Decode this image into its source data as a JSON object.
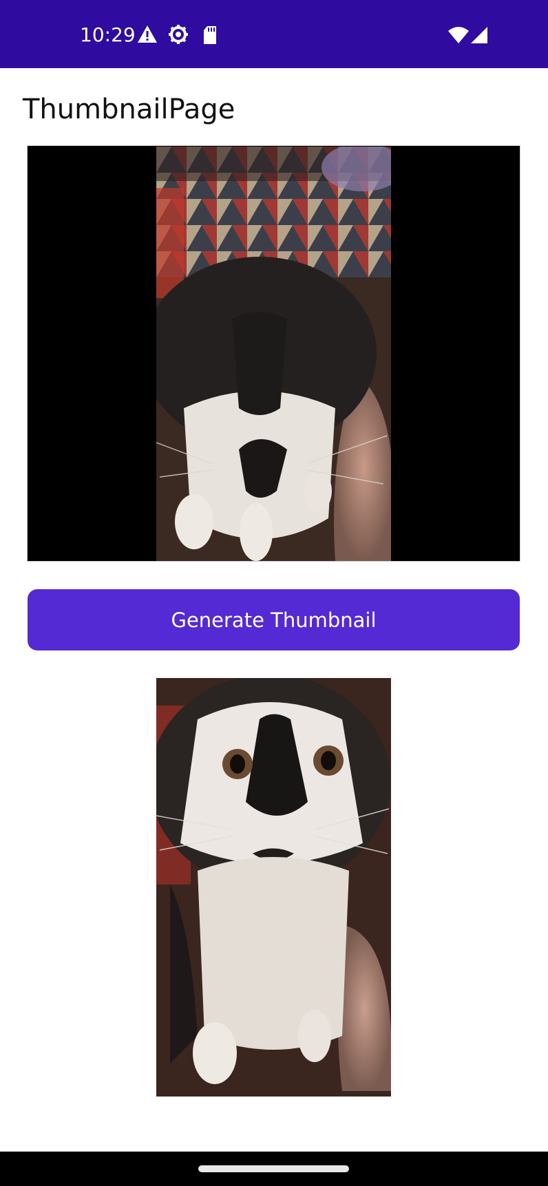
{
  "status_bar": {
    "time": "10:29",
    "icons": [
      "warning-icon",
      "gear-icon",
      "sd-card-icon",
      "wifi-icon",
      "cellular-signal-icon"
    ]
  },
  "page": {
    "title": "ThumbnailPage"
  },
  "video_player": {
    "content": "video-frame"
  },
  "generate_button": {
    "label": "Generate Thumbnail"
  },
  "thumbnail": {
    "content": "thumbnail-image"
  },
  "colors": {
    "status_bar": "#2f0c9f",
    "button": "#542ad4",
    "background": "#ffffff",
    "nav_bar": "#000000"
  }
}
